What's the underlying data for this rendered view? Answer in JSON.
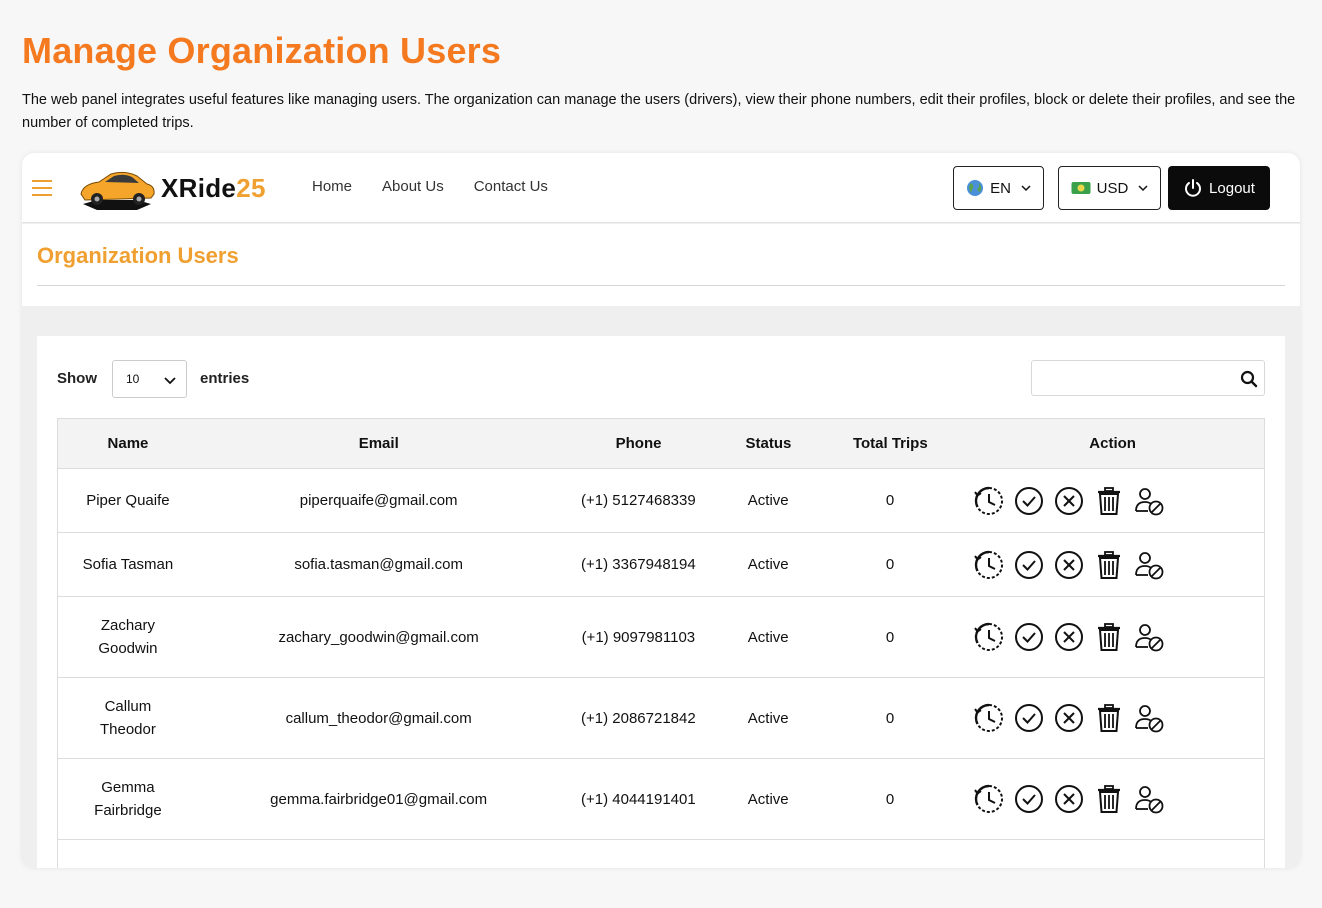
{
  "hero": {
    "title": "Manage Organization Users",
    "description": "The web panel integrates useful features like managing users. The organization can manage the users (drivers), view their phone numbers, edit their profiles, block or delete their profiles, and see the number of completed trips."
  },
  "navbar": {
    "brand_main": "XRide",
    "brand_num": "25",
    "links": [
      "Home",
      "About Us",
      "Contact Us"
    ],
    "language": "EN",
    "currency": "USD",
    "logout_label": "Logout"
  },
  "section": {
    "title": "Organization Users"
  },
  "table_controls": {
    "show_label": "Show",
    "entries_value": "10",
    "entries_label": "entries",
    "search_placeholder": ""
  },
  "table": {
    "headers": [
      "Name",
      "Email",
      "Phone",
      "Status",
      "Total Trips",
      "Action"
    ],
    "rows": [
      {
        "name": "Piper Quaife",
        "email": "piperquaife@gmail.com",
        "phone": "(+1) 5127468339",
        "status": "Active",
        "trips": "0"
      },
      {
        "name": "Sofia Tasman",
        "email": "sofia.tasman@gmail.com",
        "phone": "(+1) 3367948194",
        "status": "Active",
        "trips": "0"
      },
      {
        "name": "Zachary Goodwin",
        "email": "zachary_goodwin@gmail.com",
        "phone": "(+1) 9097981103",
        "status": "Active",
        "trips": "0"
      },
      {
        "name": "Callum Theodor",
        "email": "callum_theodor@gmail.com",
        "phone": "(+1) 2086721842",
        "status": "Active",
        "trips": "0"
      },
      {
        "name": "Gemma Fairbridge",
        "email": "gemma.fairbridge01@gmail.com",
        "phone": "(+1) 4044191401",
        "status": "Active",
        "trips": "0"
      }
    ],
    "action_icons": [
      "history-icon",
      "approve-icon",
      "reject-icon",
      "delete-icon",
      "block-user-icon"
    ]
  },
  "colors": {
    "accent": "#f4791f",
    "accent_light": "#f0a030",
    "dark": "#0b0b0b"
  }
}
